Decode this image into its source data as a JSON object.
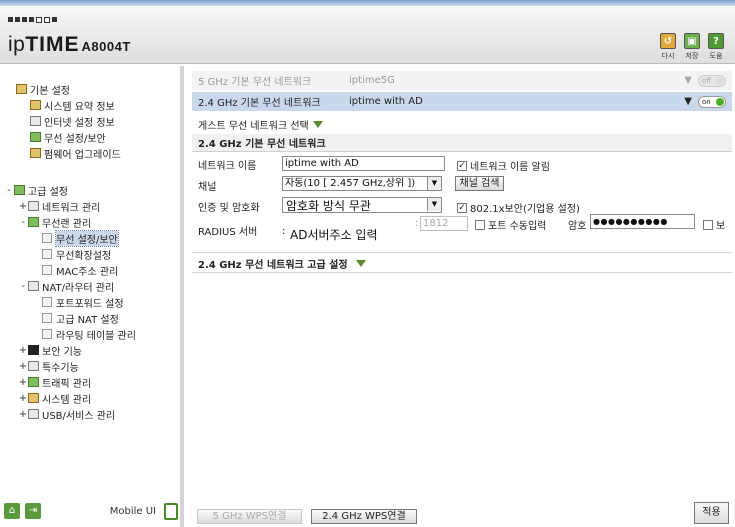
{
  "header": {
    "logo_prefix": "ip",
    "logo_brand": "TIME",
    "model": "A8004T",
    "buttons": [
      {
        "label": "다시",
        "icon": "reload-icon",
        "color": "#e1a93a"
      },
      {
        "label": "저장",
        "icon": "save-icon",
        "color": "#6ab04c"
      },
      {
        "label": "도움",
        "icon": "help-icon",
        "color": "#4f9a35"
      }
    ],
    "help_glyph": "?"
  },
  "sidebar": {
    "items": [
      {
        "label": "기본 설정",
        "toggle": "",
        "icon": "settings-icon",
        "kind": "group"
      },
      {
        "label": "시스템 요약 정보",
        "icon": "chart-icon",
        "kind": "leaf"
      },
      {
        "label": "인터넷 설정 정보",
        "icon": "network-icon",
        "kind": "leaf"
      },
      {
        "label": "무선 설정/보안",
        "icon": "wireless-icon",
        "kind": "leaf"
      },
      {
        "label": "펌웨어 업그레이드",
        "icon": "firmware-icon",
        "kind": "leaf"
      },
      {
        "label": "고급 설정",
        "toggle": "-",
        "icon": "settings-icon",
        "kind": "group"
      },
      {
        "label": "네트워크 관리",
        "toggle": "+",
        "icon": "network-icon",
        "kind": "group"
      },
      {
        "label": "무선랜 관리",
        "toggle": "-",
        "icon": "wireless-icon",
        "kind": "group"
      },
      {
        "label": "무선 설정/보안",
        "kind": "page",
        "selected": true
      },
      {
        "label": "무선확장설정",
        "kind": "page"
      },
      {
        "label": "MAC주소 관리",
        "kind": "page"
      },
      {
        "label": "NAT/라우터 관리",
        "toggle": "-",
        "icon": "router-icon",
        "kind": "group"
      },
      {
        "label": "포트포워드 설정",
        "kind": "page"
      },
      {
        "label": "고급 NAT 설정",
        "kind": "page"
      },
      {
        "label": "라우팅 테이블 관리",
        "kind": "page"
      },
      {
        "label": "보안 기능",
        "toggle": "+",
        "icon": "lock-icon",
        "kind": "group"
      },
      {
        "label": "특수기능",
        "toggle": "+",
        "icon": "special-icon",
        "kind": "group"
      },
      {
        "label": "트래픽 관리",
        "toggle": "+",
        "icon": "traffic-icon",
        "kind": "group"
      },
      {
        "label": "시스템 관리",
        "toggle": "+",
        "icon": "system-icon",
        "kind": "group"
      },
      {
        "label": "USB/서비스 관리",
        "toggle": "+",
        "icon": "usb-icon",
        "kind": "group"
      }
    ],
    "footer": {
      "mobile_label": "Mobile UI"
    }
  },
  "main": {
    "networks": [
      {
        "band": "5 GHz 기본 무선 네트워크",
        "ssid": "iptime5G",
        "toggle": "off",
        "active": false
      },
      {
        "band": "2.4 GHz 기본 무선 네트워크",
        "ssid": "iptime with AD",
        "toggle": "on",
        "active": true
      }
    ],
    "guest_select": "게스트 무선 네트워크 선택",
    "basic_section_title": "2.4 GHz 기본 무선 네트워크",
    "form": {
      "network_name_label": "네트워크 이름",
      "network_name_value": "iptime with AD",
      "hide_network_label": "네트워크 이름 알림",
      "hide_network_checked": true,
      "channel_label": "채널",
      "channel_value": "자동(10 [ 2.457 GHz,상위 ])",
      "channel_search_label": "채널 검색",
      "auth_label": "인증 및 암호화",
      "auth_value": "암호화 방식 무관",
      "dot1x_label": "802.1x보안(기업용 설정)",
      "dot1x_checked": true,
      "radius_label": "RADIUS 서버",
      "radius_placeholder": "AD서버주소 입력",
      "radius_port": "1812",
      "port_manual_label": "포트 수동입력",
      "password_label": "암호",
      "password_value": "●●●●●●●●●●",
      "show_label": "보"
    },
    "advanced_section_title": "2.4 GHz 무선 네트워크 고급 설정",
    "bottom_buttons": {
      "wps5": "5 GHz WPS연결",
      "wps24": "2.4 GHz WPS연결",
      "apply": "적용"
    }
  },
  "colors": {
    "selected_row": "#c9d8ec",
    "toggle_on": "#4caf29",
    "accent_green": "#5a8a2a"
  }
}
